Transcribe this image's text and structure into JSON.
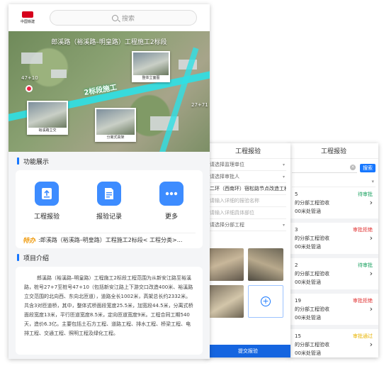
{
  "list_panel": {
    "title": "工程报验",
    "search_button": "搜索",
    "items": [
      {
        "code": "5",
        "line1": "的分部工程验收",
        "line2": "00米处管涵",
        "status": "待审批",
        "status_color": "#19a15f"
      },
      {
        "code": "3",
        "line1": "的分部工程验收",
        "line2": "00米处管涵",
        "status": "审批拒绝",
        "status_color": "#e03131"
      },
      {
        "code": "2",
        "line1": "的分部工程验收",
        "line2": "00米处管涵",
        "status": "待审批",
        "status_color": "#19a15f"
      },
      {
        "code": "19",
        "line1": "的分部工程验收",
        "line2": "00米处管涵",
        "status": "审批拒绝",
        "status_color": "#e03131"
      },
      {
        "code": "15",
        "line1": "的分部工程验收",
        "line2": "00米处管涵",
        "status": "审批通过",
        "status_color": "#e8b300"
      }
    ]
  },
  "form_panel": {
    "title": "工程报验",
    "rows": [
      {
        "text": "请选择监理单位",
        "style": "",
        "chevron": true
      },
      {
        "text": "请选择审批人",
        "style": "",
        "chevron": true
      },
      {
        "text": "二环（西南环）宿松路节点改造工程",
        "style": "dark",
        "chevron": false
      },
      {
        "text": "请输入详细的报验名称",
        "style": "ph-txt",
        "chevron": false
      },
      {
        "text": "请输入详细具体部位",
        "style": "ph-txt",
        "chevron": false
      },
      {
        "text": "请选择分部工程",
        "style": "",
        "chevron": true
      }
    ],
    "submit_label": "提交报验"
  },
  "main_panel": {
    "logo_text": "中国铁建",
    "search_placeholder": "搜索",
    "hero": {
      "title": "郎溪路（裕溪路–明皇路）工程施工2标段",
      "segment_label": "2标段施工",
      "stake_left": "47+10",
      "stake_right": "27+71",
      "thumbs": [
        "整体立面图",
        "裕溪路立交",
        "分离式高架"
      ]
    },
    "functions": {
      "title": "功能展示",
      "items": [
        {
          "label": "工程报验",
          "icon": "upload-doc-icon"
        },
        {
          "label": "报验记录",
          "icon": "document-icon"
        },
        {
          "label": "更多",
          "icon": "more-icon"
        }
      ],
      "notice_tag": "特办",
      "notice_text": ":郎溪路（裕溪路–明皇路）工程施工2标段< 工程分类>..."
    },
    "intro": {
      "title": "项目介绍",
      "text": "郎溪路（裕溪路–明皇路）工程施工2标段工程范围为从新安江路至裕溪路，桩号27+7至桩号47+10（包括新安江路上下游交口改造400米、裕溪路立交范围的北向西、东向北匝道），道路全长1002米，高架总长约2332米。共含3对匝道桥，其中，整体式桥面段宽度25.5米，加宽段44.5米，分离式桥面段宽度13米，平行匝道宽度8.5米，定向匝道宽度9米。工程合同工期540天，造价6.3亿。主要包括土石方工程、道路工程、排水工程、桥梁工程、电排工程、交通工程、照明工程及绿化工程。"
    }
  }
}
